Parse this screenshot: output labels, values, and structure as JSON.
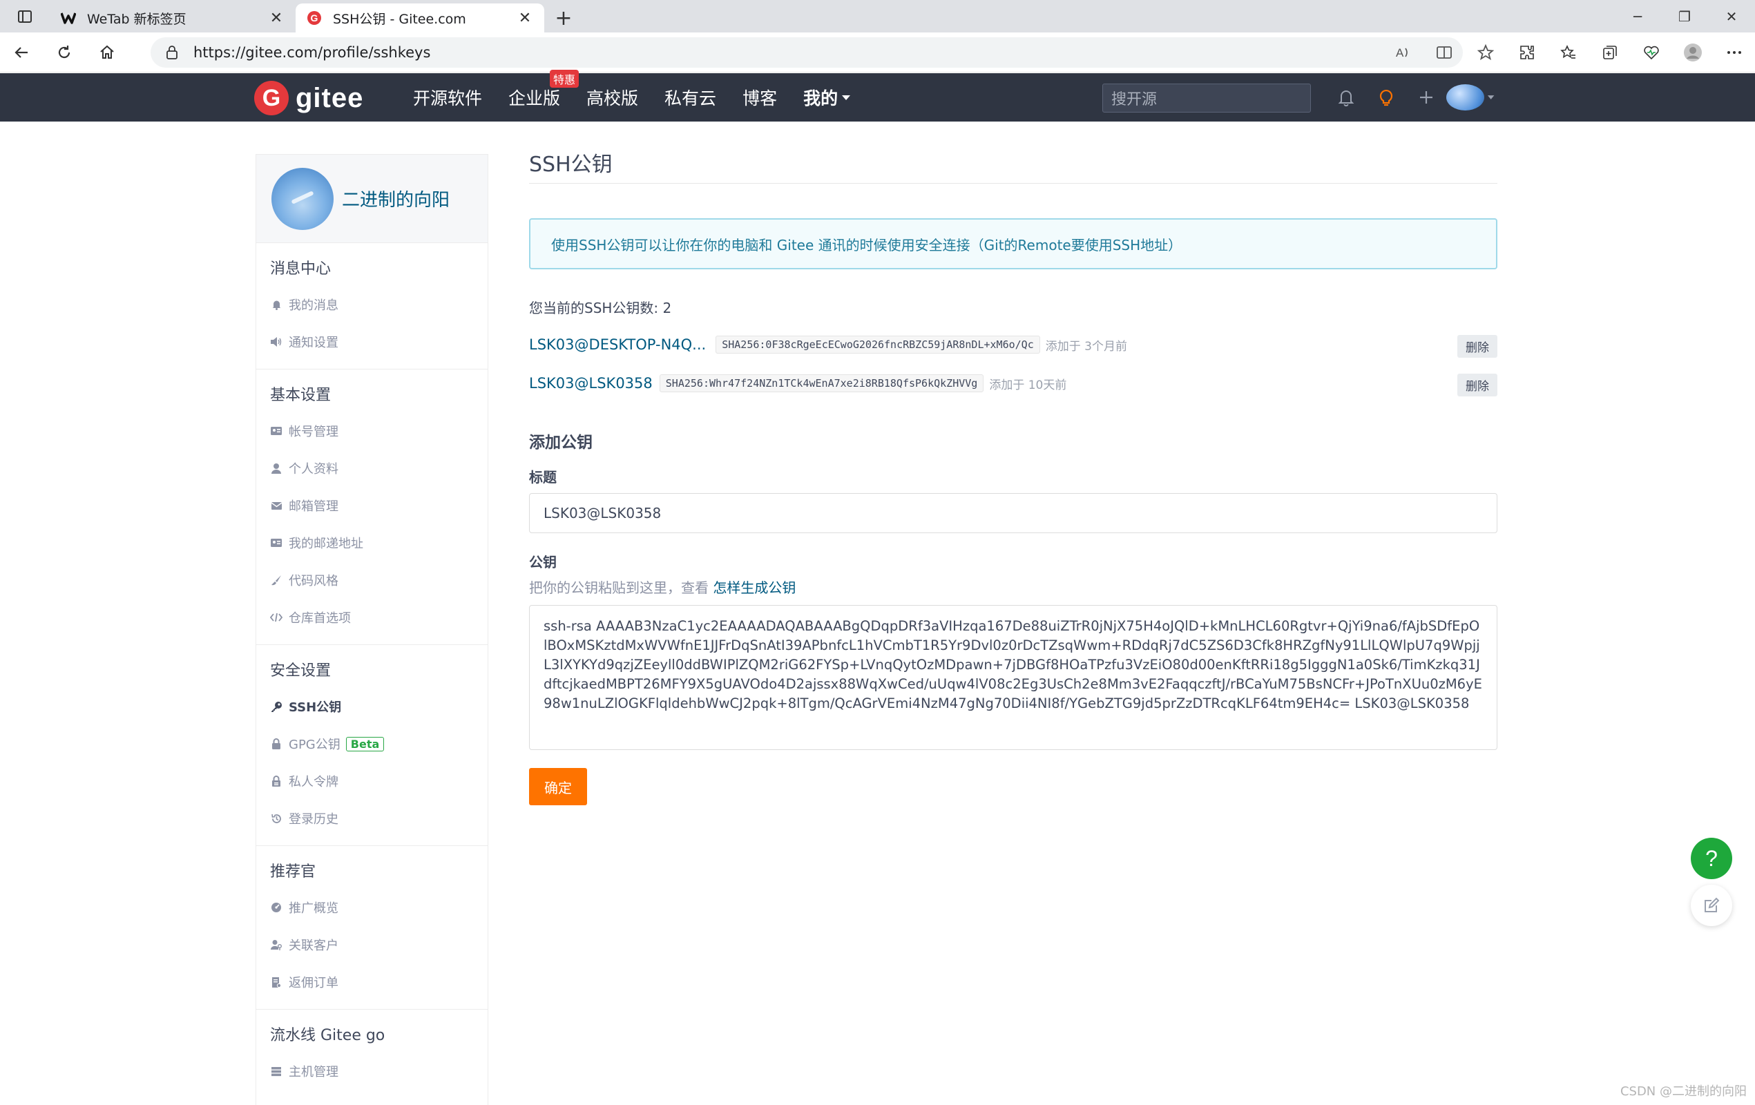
{
  "browser": {
    "tabs": [
      {
        "title": "WeTab 新标签页",
        "active": false
      },
      {
        "title": "SSH公钥 - Gitee.com",
        "active": true
      }
    ],
    "url": "https://gitee.com/profile/sshkeys"
  },
  "gitee_header": {
    "logo_text": "gitee",
    "nav": [
      {
        "label": "开源软件"
      },
      {
        "label": "企业版",
        "badge": "特惠"
      },
      {
        "label": "高校版"
      },
      {
        "label": "私有云"
      },
      {
        "label": "博客"
      },
      {
        "label": "我的"
      }
    ],
    "search_placeholder": "搜开源"
  },
  "sidebar": {
    "username": "二进制的向阳",
    "groups": [
      {
        "title": "消息中心",
        "items": [
          {
            "label": "我的消息",
            "icon": "bell-icon"
          },
          {
            "label": "通知设置",
            "icon": "speaker-icon"
          }
        ]
      },
      {
        "title": "基本设置",
        "items": [
          {
            "label": "帐号管理",
            "icon": "id-card-icon"
          },
          {
            "label": "个人资料",
            "icon": "user-icon"
          },
          {
            "label": "邮箱管理",
            "icon": "envelope-icon"
          },
          {
            "label": "我的邮递地址",
            "icon": "address-card-icon"
          },
          {
            "label": "代码风格",
            "icon": "brush-icon"
          },
          {
            "label": "仓库首选项",
            "icon": "code-icon"
          }
        ]
      },
      {
        "title": "安全设置",
        "items": [
          {
            "label": "SSH公钥",
            "icon": "key-icon",
            "active": true
          },
          {
            "label": "GPG公钥",
            "icon": "lock-icon",
            "badge": "Beta"
          },
          {
            "label": "私人令牌",
            "icon": "token-icon"
          },
          {
            "label": "登录历史",
            "icon": "history-icon"
          }
        ]
      },
      {
        "title": "推荐官",
        "items": [
          {
            "label": "推广概览",
            "icon": "dashboard-icon"
          },
          {
            "label": "关联客户",
            "icon": "user-key-icon"
          },
          {
            "label": "返佣订单",
            "icon": "receipt-icon"
          }
        ]
      },
      {
        "title": "流水线 Gitee go",
        "items": [
          {
            "label": "主机管理",
            "icon": "server-icon"
          }
        ]
      }
    ]
  },
  "main": {
    "title": "SSH公钥",
    "info": "使用SSH公钥可以让你在你的电脑和 Gitee 通讯的时候使用安全连接（Git的Remote要使用SSH地址）",
    "count_text": "您当前的SSH公钥数: 2",
    "keys": [
      {
        "name": "LSK03@DESKTOP-N4Q...",
        "fingerprint": "SHA256:0F38cRgeEcECwoG2026fncRBZC59jAR8nDL+xM6o/Qc",
        "added": "添加于 3个月前",
        "delete_label": "删除"
      },
      {
        "name": "LSK03@LSK0358",
        "fingerprint": "SHA256:Whr47f24NZn1TCk4wEnA7xe2i8RB18QfsP6kQkZHVVg",
        "added": "添加于 10天前",
        "delete_label": "删除"
      }
    ],
    "add_title": "添加公钥",
    "title_label": "标题",
    "title_value": "LSK03@LSK0358",
    "key_label": "公钥",
    "key_hint": "把你的公钥粘贴到这里，查看",
    "key_hint_link": "怎样生成公钥",
    "key_value": "ssh-rsa AAAAB3NzaC1yc2EAAAADAQABAAABgQDqpDRf3aVIHzqa167De88uiZTrR0jNjX75H4oJQlD+kMnLHCL60Rgtvr+QjYi9na6/fAjbSDfEpOlBOxMSKztdMxWVWfnE1JJFrDqSnAtI39APbnfcL1hVCmbT1R5Yr9Dvl0z0rDcTZsqWwm+RDdqRj7dC5ZS6D3Cfk8HRZgfNy91LlLQWlpU7q9WpjjL3lXYKYd9qzjZEeyll0ddBWIPlZQM2riG62FYSp+LVnqQytOzMDpawn+7jDBGf8HOaTPzfu3VzEiO80d00enKftRRi18g5IgggN1a0Sk6/TimKzkq31JdftcjkaedMBPT26MFY9X5gUAVOdo4D2ajssx88WqXwCed/uUqw4lV08c2Eg3UsCh2e8Mm3vE2FaqqczftJ/rBCaYuM75BsNCFr+JPoTnXUu0zM6yE98w1nuLZlOGKFlqldehbWwCJ2pqk+8lTgm/QcAGrVEmi4NzM47gNg70Dii4NI8f/YGebZTG9jd5prZzDTRcqKLF64tm9EH4c= LSK03@LSK0358",
    "submit_label": "确定"
  },
  "watermark": "CSDN @二进制的向阳"
}
